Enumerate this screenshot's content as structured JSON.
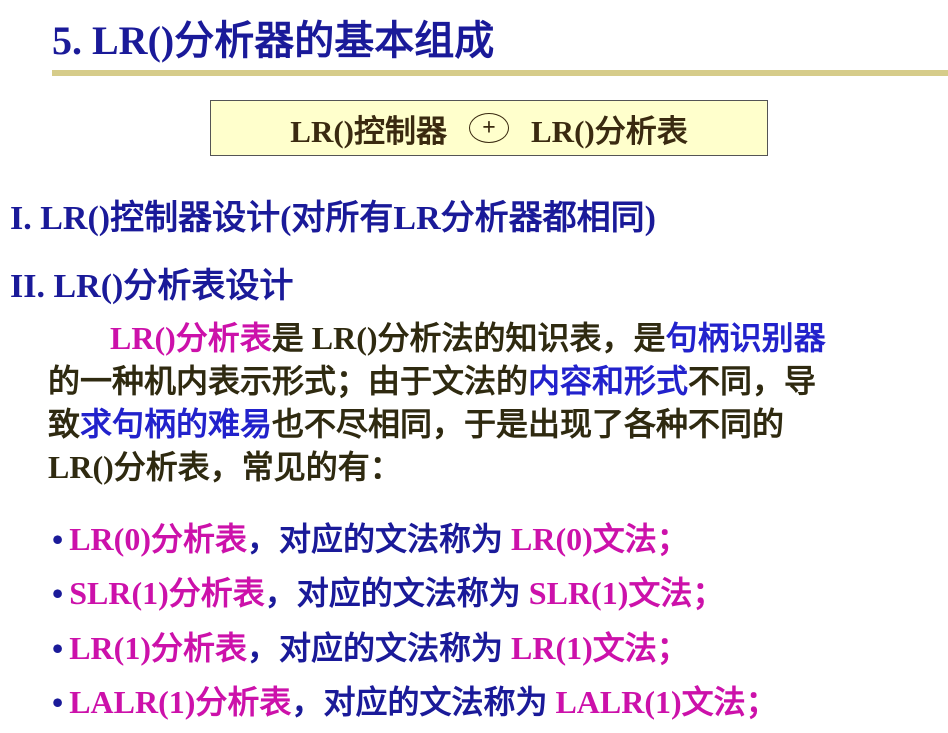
{
  "title": "5. LR()分析器的基本组成",
  "box": {
    "left": "LR()控制器",
    "plus": "+",
    "right": "LR()分析表"
  },
  "section1": "I. LR()控制器设计(对所有LR分析器都相同)",
  "section2": "II. LR()分析表设计",
  "paragraph": {
    "l1a": "LR()分析表",
    "l1b": "是 LR()分析法的知识表，是",
    "l1c": "句柄识别器",
    "l2a": "的一种机内表示形式；由于文法的",
    "l2b": "内容和形式",
    "l2c": "不同，导",
    "l3a": "致",
    "l3b": "求句柄的难易",
    "l3c": "也不尽相同，于是出现了各种不同的",
    "l4": "LR()分析表，常见的有："
  },
  "bullets": [
    {
      "dot": "•",
      "name": "LR(0)分析表",
      "mid": "，对应的文法称为 ",
      "grammar": "LR(0)文法；"
    },
    {
      "dot": "•",
      "name": "SLR(1)分析表",
      "mid": "，对应的文法称为 ",
      "grammar": "SLR(1)文法；"
    },
    {
      "dot": "•",
      "name": "LR(1)分析表",
      "mid": "，对应的文法称为 ",
      "grammar": "LR(1)文法；"
    },
    {
      "dot": "•",
      "name": "LALR(1)分析表",
      "mid": "，对应的文法称为 ",
      "grammar": "LALR(1)文法；"
    }
  ]
}
